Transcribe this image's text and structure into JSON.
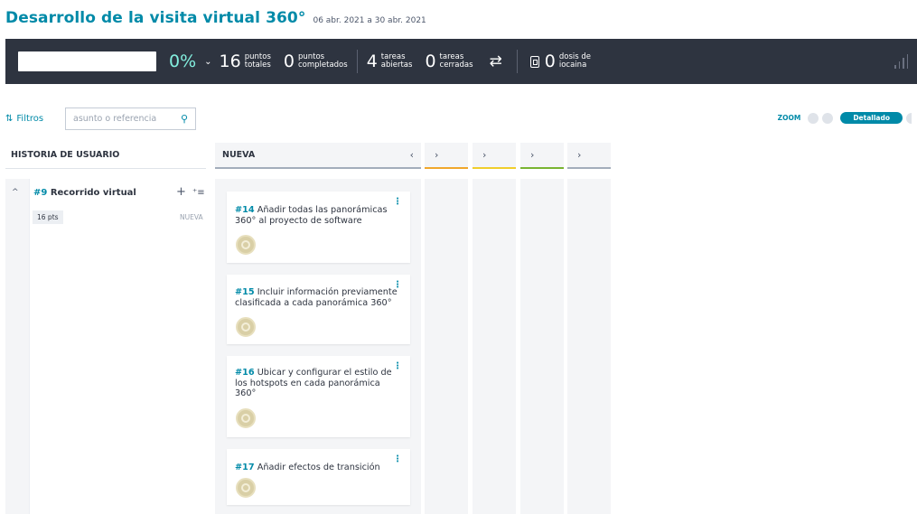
{
  "header": {
    "title": "Desarrollo de la visita virtual 360°",
    "dates": "06 abr. 2021 a 30 abr. 2021"
  },
  "stats": {
    "progress": "0%",
    "progress_value": 0,
    "total_points": {
      "value": "16",
      "label1": "puntos",
      "label2": "totales"
    },
    "completed_points": {
      "value": "0",
      "label1": "puntos",
      "label2": "completados"
    },
    "open_tasks": {
      "value": "4",
      "label1": "tareas",
      "label2": "abiertas"
    },
    "closed_tasks": {
      "value": "0",
      "label1": "tareas",
      "label2": "cerradas"
    },
    "iocaine": {
      "value": "0",
      "label1": "dosis de",
      "label2": "iocaina"
    }
  },
  "toolbar": {
    "filters_label": "Filtros",
    "search_placeholder": "asunto o referencia",
    "zoom_label": "ZOOM",
    "zoom_active": "Detallado"
  },
  "board": {
    "user_story_header": "HISTORIA DE USUARIO",
    "columns": [
      {
        "name": "NUEVA",
        "color": "#a3adbb"
      },
      {
        "name": "",
        "color": "#f0a72c"
      },
      {
        "name": "",
        "color": "#f0ce2c"
      },
      {
        "name": "",
        "color": "#79b431"
      },
      {
        "name": "",
        "color": "#a3adbb"
      }
    ],
    "user_story": {
      "ref": "#9",
      "title": "Recorrido virtual",
      "points": "16 pts",
      "status": "NUEVA"
    },
    "cards": [
      {
        "ref": "#14",
        "text": "Añadir todas las panorámicas 360° al proyecto de software"
      },
      {
        "ref": "#15",
        "text": "Incluir información previamente clasificada a cada panorámica 360°"
      },
      {
        "ref": "#16",
        "text": "Ubicar y configurar el estilo de los hotspots en cada panorámica 360°"
      },
      {
        "ref": "#17",
        "text": "Añadir efectos de transición"
      }
    ]
  },
  "colors": {
    "accent": "#008aa8",
    "stats_bg": "#2e3440",
    "progress": "#83eede"
  }
}
